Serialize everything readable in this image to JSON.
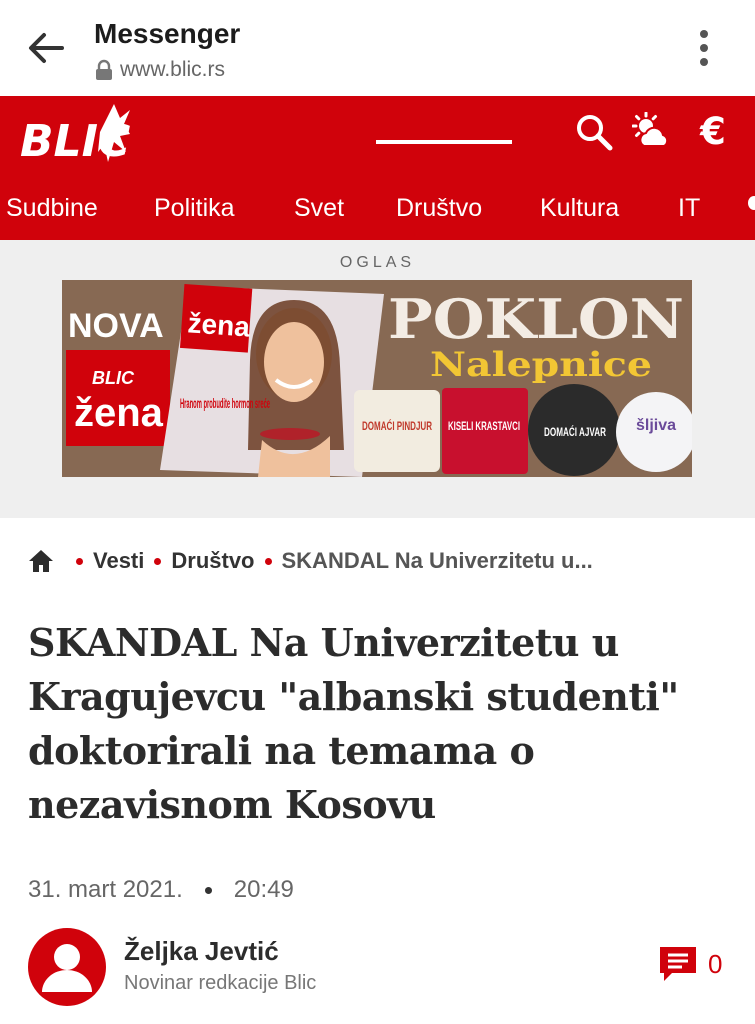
{
  "browser": {
    "app_title": "Messenger",
    "url": "www.blic.rs"
  },
  "site": {
    "logo_text": "BLIC",
    "currency_symbol": "€",
    "nav": [
      {
        "label": "Sudbine"
      },
      {
        "label": "Politika"
      },
      {
        "label": "Svet"
      },
      {
        "label": "Društvo",
        "active": true
      },
      {
        "label": "Kultura"
      },
      {
        "label": "IT"
      }
    ],
    "brand_color": "#d0020b"
  },
  "ad": {
    "label": "OGLAS",
    "texts": {
      "nova": "NOVA",
      "magazine_brand": "BLIC",
      "magazine_name": "žena",
      "headline": "POKLON",
      "subheadline": "Nalepnice",
      "cover_line": "Hranom probudite hormon sreće",
      "jar1": "DOMAĆI PINDJUR",
      "jar2": "KISELI KRASTAVCI",
      "jar3": "DOMAĆI AJVAR",
      "jar4": "šljiva"
    }
  },
  "breadcrumb": {
    "items": [
      "Vesti",
      "Društvo"
    ],
    "current": "SKANDAL Na Univerzitetu u..."
  },
  "article": {
    "headline": "SKANDAL Na Univerzitetu u Kragujevcu \"albanski studenti\" doktorirali na temama o nezavisnom Kosovu",
    "date": "31. mart 2021.",
    "time": "20:49",
    "author_name": "Željka Jevtić",
    "author_role": "Novinar redkacije Blic",
    "comment_count": "0"
  }
}
